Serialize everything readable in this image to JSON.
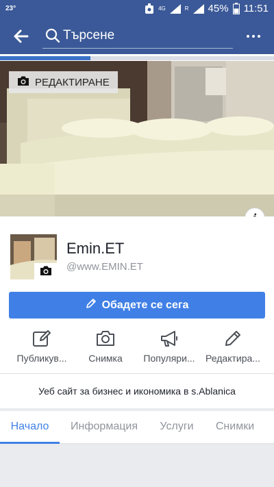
{
  "status_bar": {
    "temperature": "23°",
    "network": "4G",
    "roaming": "R",
    "battery": "45%",
    "time": "11:51"
  },
  "app_bar": {
    "search_placeholder": "Търсене"
  },
  "progress": {
    "fraction": 0.33
  },
  "cover": {
    "edit_label": "РЕДАКТИРАНЕ"
  },
  "page": {
    "name": "Emin.ET",
    "username": "@www.EMIN.ET"
  },
  "call_button": {
    "label": "Обадете се сега"
  },
  "actions": [
    {
      "label": "Публикув...",
      "icon": "compose-icon"
    },
    {
      "label": "Снимка",
      "icon": "camera-icon"
    },
    {
      "label": "Популяри...",
      "icon": "megaphone-icon"
    },
    {
      "label": "Редактира...",
      "icon": "pencil-icon"
    }
  ],
  "about": {
    "text": "Уеб сайт за бизнес и икономика в s.Ablanica"
  },
  "tabs": [
    {
      "label": "Начало",
      "active": true
    },
    {
      "label": "Информация",
      "active": false
    },
    {
      "label": "Услуги",
      "active": false
    },
    {
      "label": "Снимки",
      "active": false
    }
  ],
  "colors": {
    "brand": "#3b5998",
    "accent": "#4080e6",
    "muted_text": "#90949c"
  }
}
